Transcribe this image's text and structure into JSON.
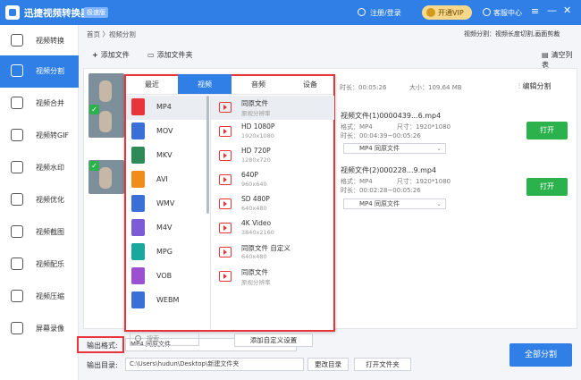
{
  "titlebar": {
    "app_title": "迅捷视频转换器",
    "badge": "极速版",
    "login": "注册/登录",
    "vip": "开通VIP",
    "service": "客服中心",
    "menu_icon": "≡",
    "min_icon": "—",
    "close_icon": "✕"
  },
  "sidebar": {
    "items": [
      {
        "label": "视频转换",
        "icon": "video-convert-icon"
      },
      {
        "label": "视频分割",
        "icon": "video-split-icon"
      },
      {
        "label": "视频合并",
        "icon": "video-merge-icon"
      },
      {
        "label": "视频转GIF",
        "icon": "gif-icon"
      },
      {
        "label": "视频水印",
        "icon": "watermark-icon"
      },
      {
        "label": "视频优化",
        "icon": "optimize-icon"
      },
      {
        "label": "视频截图",
        "icon": "screenshot-icon"
      },
      {
        "label": "视频配乐",
        "icon": "music-icon"
      },
      {
        "label": "视频压缩",
        "icon": "compress-icon"
      },
      {
        "label": "屏幕录像",
        "icon": "record-icon"
      }
    ],
    "active_label": "视频分割"
  },
  "main": {
    "breadcrumb": "首页 〉视频分割",
    "hint": "视频分割：视频长度切割,画面剪裁",
    "toolbar": {
      "add_file": "添加文件",
      "add_folder": "添加文件夹",
      "clear_list": "清空列表"
    },
    "files": [
      {
        "time_label": "时长：",
        "duration": "00:05:26",
        "size_label": "大小：",
        "size": "109.64 MB",
        "edit": "编辑分割"
      },
      {
        "name": "视频文件(1)0000439...6.mp4",
        "format_label": "格式：",
        "format": "MP4",
        "res_label": "尺寸：",
        "resolution": "1920*1080",
        "range_label": "时长：",
        "range": "00:04:39~00:05:26",
        "out_format": "MP4 同原文件",
        "open": "打开"
      },
      {
        "name": "视频文件(2)000228...9.mp4",
        "format_label": "格式：",
        "format": "MP4",
        "res_label": "尺寸：",
        "resolution": "1920*1080",
        "range_label": "时长：",
        "range": "00:02:28~00:05:26",
        "out_format": "MP4 同原文件",
        "open": "打开"
      }
    ]
  },
  "popup": {
    "tabs": [
      "最近",
      "视频",
      "音频",
      "设备"
    ],
    "active_tab": "视频",
    "formats": [
      "MP4",
      "MOV",
      "MKV",
      "AVI",
      "WMV",
      "M4V",
      "MPG",
      "VOB",
      "WEBM"
    ],
    "format_colors": [
      "#e8343a",
      "#3a6fd8",
      "#2e8b57",
      "#f08c1a",
      "#3a6fd8",
      "#7b5cd6",
      "#1aa89c",
      "#9b4fd1",
      "#3a6fd8"
    ],
    "search_placeholder": "搜索",
    "qualities": [
      {
        "name": "同原文件",
        "sub": "原视分辨率"
      },
      {
        "name": "HD 1080P",
        "sub": "1920x1080"
      },
      {
        "name": "HD 720P",
        "sub": "1280x720"
      },
      {
        "name": "640P",
        "sub": "960x640"
      },
      {
        "name": "SD 480P",
        "sub": "640x480"
      },
      {
        "name": "4K Video",
        "sub": "3840x2160"
      },
      {
        "name": "同原文件 自定义",
        "sub": "640x480"
      },
      {
        "name": "同原文件",
        "sub": "原视分辨率"
      }
    ],
    "add_custom": "添加自定义设置"
  },
  "bottom": {
    "out_format_label": "输出格式:",
    "out_format_value": "MP4 同原文件",
    "out_dir_label": "输出目录:",
    "out_dir_value": "C:\\Users\\hudun\\Desktop\\新建文件夹",
    "change_dir": "更改目录",
    "open_folder": "打开文件夹",
    "split_all": "全部分割"
  }
}
